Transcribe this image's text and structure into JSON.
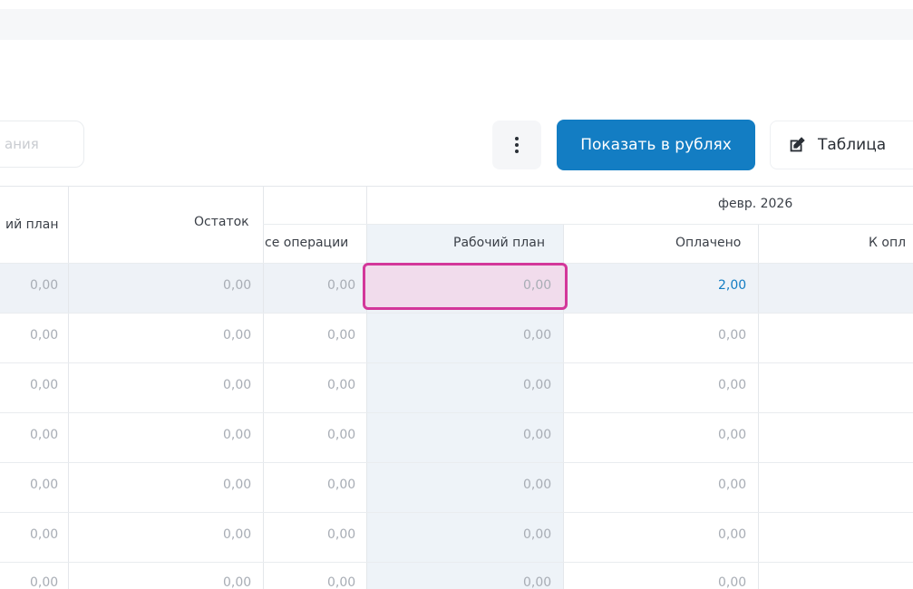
{
  "toolbar": {
    "search_placeholder": "ания",
    "more_icon": "more-vertical-icon",
    "show_rubles_label": "Показать в рублях",
    "table_label": "Таблица",
    "table_icon": "edit-icon",
    "accent_color": "#137dc3"
  },
  "table": {
    "headers": {
      "work_plan_left": "ий план",
      "balance": "Остаток",
      "all_operations": "се операции",
      "month_group": "февр. 2026",
      "work_plan": "Рабочий план",
      "paid": "Оплачено",
      "to_pay": "К опл"
    },
    "rows": [
      {
        "work_plan_left": "0,00",
        "balance": "0,00",
        "all_operations": "0,00",
        "work_plan": "0,00",
        "paid": "2,00"
      },
      {
        "work_plan_left": "0,00",
        "balance": "0,00",
        "all_operations": "0,00",
        "work_plan": "0,00",
        "paid": "0,00"
      },
      {
        "work_plan_left": "0,00",
        "balance": "0,00",
        "all_operations": "0,00",
        "work_plan": "0,00",
        "paid": "0,00"
      },
      {
        "work_plan_left": "0,00",
        "balance": "0,00",
        "all_operations": "0,00",
        "work_plan": "0,00",
        "paid": "0,00"
      },
      {
        "work_plan_left": "0,00",
        "balance": "0,00",
        "all_operations": "0,00",
        "work_plan": "0,00",
        "paid": "0,00"
      },
      {
        "work_plan_left": "0,00",
        "balance": "0,00",
        "all_operations": "0,00",
        "work_plan": "0,00",
        "paid": "0,00"
      },
      {
        "work_plan_left": "0,00",
        "balance": "0,00",
        "all_operations": "0,00",
        "work_plan": "0,00",
        "paid": "0,00"
      }
    ],
    "selected_cell_color": "#d3379a"
  }
}
